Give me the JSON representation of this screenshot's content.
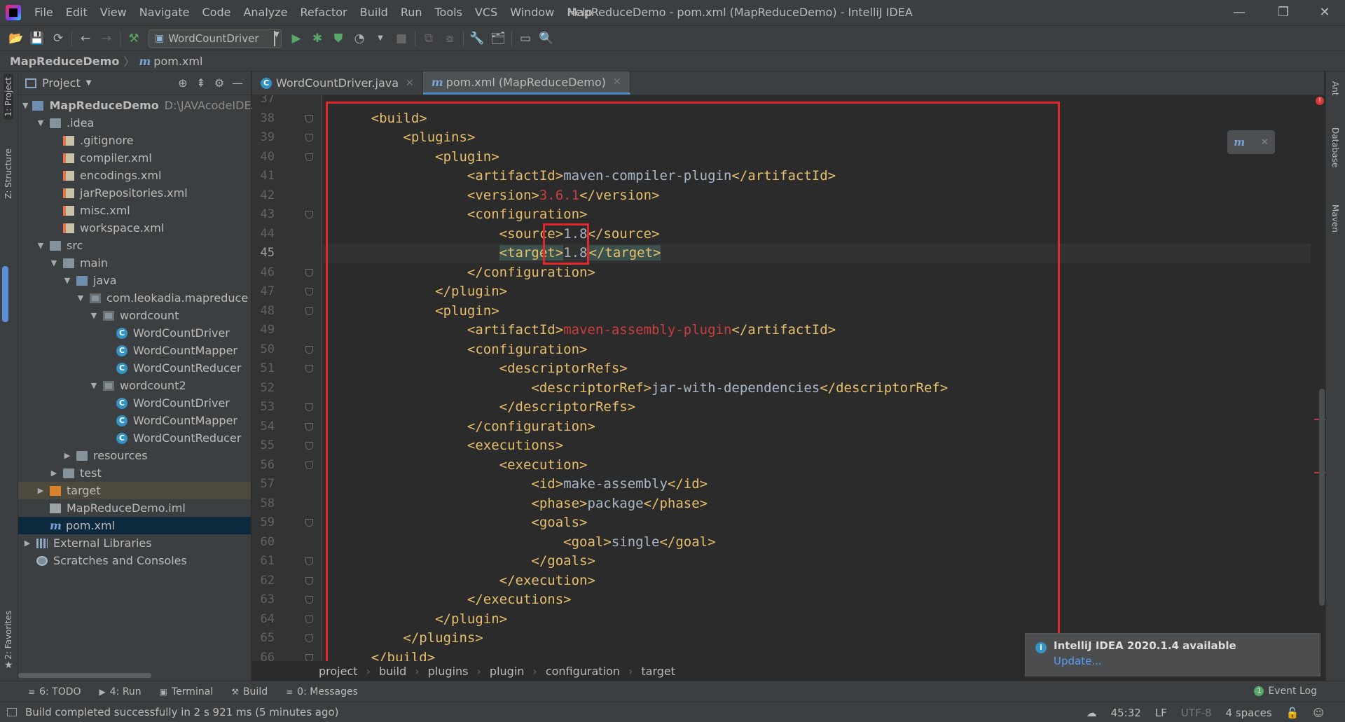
{
  "window": {
    "title": "MapReduceDemo - pom.xml (MapReduceDemo) - IntelliJ IDEA",
    "minimize_glyph": "—",
    "restore_glyph": "❐",
    "close_glyph": "✕"
  },
  "menu": [
    "File",
    "Edit",
    "View",
    "Navigate",
    "Code",
    "Analyze",
    "Refactor",
    "Build",
    "Run",
    "Tools",
    "VCS",
    "Window",
    "Help"
  ],
  "toolbar": {
    "run_config": "WordCountDriver"
  },
  "navbar": {
    "project": "MapReduceDemo",
    "file": "pom.xml",
    "m_glyph": "m"
  },
  "left_stripe": {
    "project_label": "1: Project",
    "structure_label": "Z: Structure",
    "favorites_label": "2: Favorites"
  },
  "right_stripe": {
    "ant_label": "Ant",
    "database_label": "Database",
    "maven_label": "Maven"
  },
  "project_panel": {
    "title": "Project",
    "tree": [
      {
        "label": "MapReduceDemo",
        "path": "D:\\JAVAcodeIDEA\\I",
        "level": 0,
        "arrow": "down",
        "icon": "folder-blue",
        "bold": true
      },
      {
        "label": ".idea",
        "level": 1,
        "arrow": "down",
        "icon": "folder"
      },
      {
        "label": ".gitignore",
        "level": 2,
        "icon": "xmlfile"
      },
      {
        "label": "compiler.xml",
        "level": 2,
        "icon": "xmlfile"
      },
      {
        "label": "encodings.xml",
        "level": 2,
        "icon": "xmlfile"
      },
      {
        "label": "jarRepositories.xml",
        "level": 2,
        "icon": "xmlfile"
      },
      {
        "label": "misc.xml",
        "level": 2,
        "icon": "xmlfile"
      },
      {
        "label": "workspace.xml",
        "level": 2,
        "icon": "xmlfile"
      },
      {
        "label": "src",
        "level": 1,
        "arrow": "down",
        "icon": "folder"
      },
      {
        "label": "main",
        "level": 2,
        "arrow": "down",
        "icon": "folder"
      },
      {
        "label": "java",
        "level": 3,
        "arrow": "down",
        "icon": "folder-blue"
      },
      {
        "label": "com.leokadia.mapreduce",
        "level": 4,
        "arrow": "down",
        "icon": "folder-pkg"
      },
      {
        "label": "wordcount",
        "level": 5,
        "arrow": "down",
        "icon": "folder-pkg"
      },
      {
        "label": "WordCountDriver",
        "level": 6,
        "icon": "classfile"
      },
      {
        "label": "WordCountMapper",
        "level": 6,
        "icon": "classfile"
      },
      {
        "label": "WordCountReducer",
        "level": 6,
        "icon": "classfile"
      },
      {
        "label": "wordcount2",
        "level": 5,
        "arrow": "down",
        "icon": "folder-pkg"
      },
      {
        "label": "WordCountDriver",
        "level": 6,
        "icon": "classfile"
      },
      {
        "label": "WordCountMapper",
        "level": 6,
        "icon": "classfile"
      },
      {
        "label": "WordCountReducer",
        "level": 6,
        "icon": "classfile"
      },
      {
        "label": "resources",
        "level": 3,
        "arrow": "right",
        "icon": "folder"
      },
      {
        "label": "test",
        "level": 2,
        "arrow": "right",
        "icon": "folder"
      },
      {
        "label": "target",
        "level": 1,
        "arrow": "right",
        "icon": "folder-orange",
        "excluded": true
      },
      {
        "label": "MapReduceDemo.iml",
        "level": 1,
        "icon": "imlfile"
      },
      {
        "label": "pom.xml",
        "level": 1,
        "icon": "maven",
        "selected": true
      },
      {
        "label": "External Libraries",
        "level": 0,
        "arrow": "right",
        "icon": "libs"
      },
      {
        "label": "Scratches and Consoles",
        "level": 0,
        "icon": "scratch"
      }
    ]
  },
  "tabs": [
    {
      "label": "WordCountDriver.java",
      "icon": "classfile",
      "active": false
    },
    {
      "label": "pom.xml (MapReduceDemo)",
      "icon": "maven",
      "active": true
    }
  ],
  "editor": {
    "current_line": 45,
    "lines": [
      {
        "n": 37,
        "indent": 0,
        "parts": []
      },
      {
        "n": 38,
        "indent": 1,
        "parts": [
          [
            "tag",
            "<build>"
          ]
        ]
      },
      {
        "n": 39,
        "indent": 2,
        "parts": [
          [
            "tag",
            "<plugins>"
          ]
        ]
      },
      {
        "n": 40,
        "indent": 3,
        "parts": [
          [
            "tag",
            "<plugin>"
          ]
        ]
      },
      {
        "n": 41,
        "indent": 4,
        "parts": [
          [
            "tag",
            "<artifactId>"
          ],
          [
            "txt",
            "maven-compiler-plugin"
          ],
          [
            "tag",
            "</artifactId>"
          ]
        ]
      },
      {
        "n": 42,
        "indent": 4,
        "parts": [
          [
            "tag",
            "<version>"
          ],
          [
            "red",
            "3.6.1"
          ],
          [
            "tag",
            "</version>"
          ]
        ]
      },
      {
        "n": 43,
        "indent": 4,
        "parts": [
          [
            "tag",
            "<configuration>"
          ]
        ]
      },
      {
        "n": 44,
        "indent": 5,
        "parts": [
          [
            "tag",
            "<source>"
          ],
          [
            "txt",
            "1.8"
          ],
          [
            "tag",
            "</source>"
          ]
        ]
      },
      {
        "n": 45,
        "indent": 5,
        "parts": [
          [
            "taghl",
            "<target>"
          ],
          [
            "txt",
            "1.8"
          ],
          [
            "caret",
            ""
          ],
          [
            "taghl",
            "</target>"
          ]
        ]
      },
      {
        "n": 46,
        "indent": 4,
        "parts": [
          [
            "tag",
            "</configuration>"
          ]
        ]
      },
      {
        "n": 47,
        "indent": 3,
        "parts": [
          [
            "tag",
            "</plugin>"
          ]
        ]
      },
      {
        "n": 48,
        "indent": 3,
        "parts": [
          [
            "tag",
            "<plugin>"
          ]
        ]
      },
      {
        "n": 49,
        "indent": 4,
        "parts": [
          [
            "tag",
            "<artifactId>"
          ],
          [
            "red",
            "maven-assembly-plugin"
          ],
          [
            "tag",
            "</artifactId>"
          ]
        ]
      },
      {
        "n": 50,
        "indent": 4,
        "parts": [
          [
            "tag",
            "<configuration>"
          ]
        ]
      },
      {
        "n": 51,
        "indent": 5,
        "parts": [
          [
            "tag",
            "<descriptorRefs>"
          ]
        ]
      },
      {
        "n": 52,
        "indent": 6,
        "parts": [
          [
            "tag",
            "<descriptorRef>"
          ],
          [
            "txt",
            "jar-with-dependencies"
          ],
          [
            "tag",
            "</descriptorRef>"
          ]
        ]
      },
      {
        "n": 53,
        "indent": 5,
        "parts": [
          [
            "tag",
            "</descriptorRefs>"
          ]
        ]
      },
      {
        "n": 54,
        "indent": 4,
        "parts": [
          [
            "tag",
            "</configuration>"
          ]
        ]
      },
      {
        "n": 55,
        "indent": 4,
        "parts": [
          [
            "tag",
            "<executions>"
          ]
        ]
      },
      {
        "n": 56,
        "indent": 5,
        "parts": [
          [
            "tag",
            "<execution>"
          ]
        ]
      },
      {
        "n": 57,
        "indent": 6,
        "parts": [
          [
            "tag",
            "<id>"
          ],
          [
            "txt",
            "make-assembly"
          ],
          [
            "tag",
            "</id>"
          ]
        ]
      },
      {
        "n": 58,
        "indent": 6,
        "parts": [
          [
            "tag",
            "<phase>"
          ],
          [
            "txt",
            "package"
          ],
          [
            "tag",
            "</phase>"
          ]
        ]
      },
      {
        "n": 59,
        "indent": 6,
        "parts": [
          [
            "tag",
            "<goals>"
          ]
        ]
      },
      {
        "n": 60,
        "indent": 7,
        "parts": [
          [
            "tag",
            "<goal>"
          ],
          [
            "txt",
            "single"
          ],
          [
            "tag",
            "</goal>"
          ]
        ]
      },
      {
        "n": 61,
        "indent": 6,
        "parts": [
          [
            "tag",
            "</goals>"
          ]
        ]
      },
      {
        "n": 62,
        "indent": 5,
        "parts": [
          [
            "tag",
            "</execution>"
          ]
        ]
      },
      {
        "n": 63,
        "indent": 4,
        "parts": [
          [
            "tag",
            "</executions>"
          ]
        ]
      },
      {
        "n": 64,
        "indent": 3,
        "parts": [
          [
            "tag",
            "</plugin>"
          ]
        ]
      },
      {
        "n": 65,
        "indent": 2,
        "parts": [
          [
            "tag",
            "</plugins>"
          ]
        ]
      },
      {
        "n": 66,
        "indent": 1,
        "parts": [
          [
            "tag",
            "</build>"
          ]
        ]
      }
    ],
    "fold_lines": [
      38,
      39,
      40,
      43,
      46,
      47,
      48,
      50,
      51,
      53,
      54,
      55,
      56,
      59,
      61,
      62,
      63,
      64,
      65,
      66
    ]
  },
  "editor_breadcrumb": [
    "project",
    "build",
    "plugins",
    "plugin",
    "configuration",
    "target"
  ],
  "notification": {
    "title": "IntelliJ IDEA 2020.1.4 available",
    "link": "Update..."
  },
  "tool_windows": [
    {
      "label": "6: TODO",
      "icon": "≡"
    },
    {
      "label": "4: Run",
      "icon": "▶"
    },
    {
      "label": "Terminal",
      "icon": "▣"
    },
    {
      "label": "Build",
      "icon": "⚒"
    },
    {
      "label": "0: Messages",
      "icon": "≡"
    }
  ],
  "event_log": {
    "label": "Event Log",
    "count": "1"
  },
  "status": {
    "message": "Build completed successfully in 2 s 921 ms (5 minutes ago)",
    "position": "45:32",
    "line_sep": "LF",
    "encoding": "UTF-8",
    "indent": "4 spaces"
  },
  "colors": {
    "tag": "#e8bf6a",
    "text": "#a9b7c6",
    "error_value": "#cc3e3e",
    "annotation_box": "#e0282d",
    "selection": "#0d293e"
  }
}
